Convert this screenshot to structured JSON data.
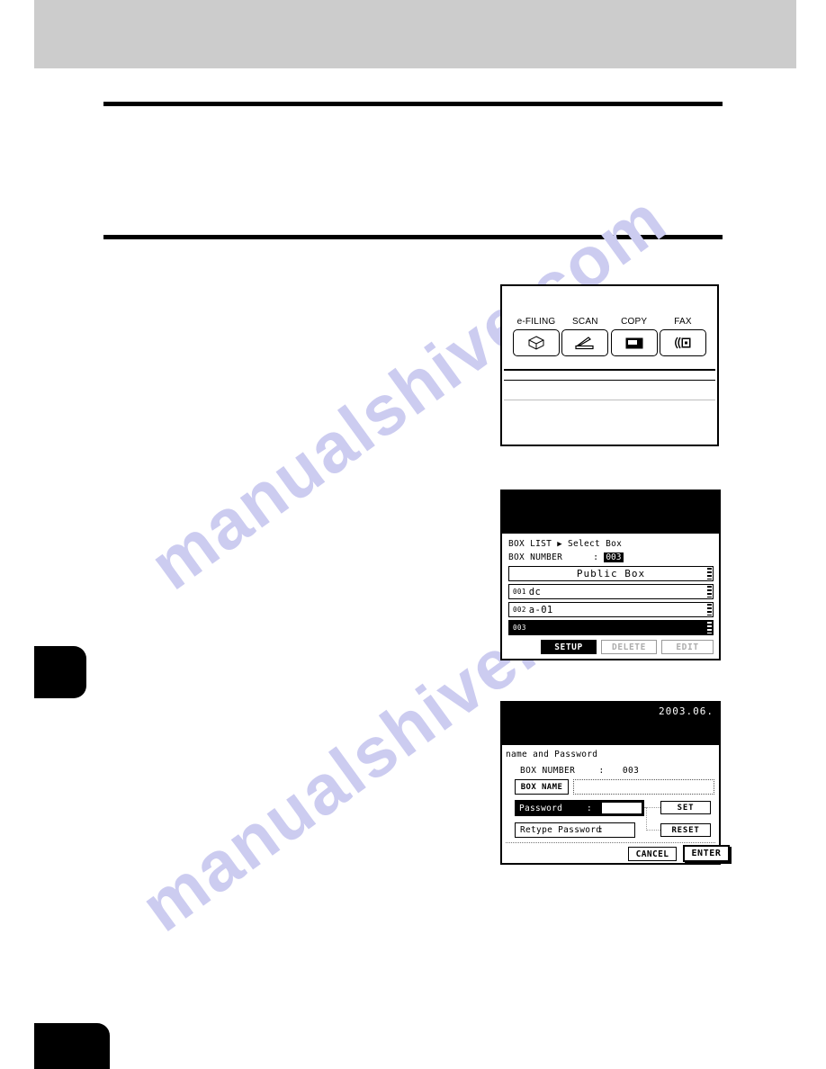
{
  "page": {
    "watermark_line_1": "manualshive.com",
    "watermark_line_2": "manualshive.com"
  },
  "panel_functions": {
    "name": "function-select-panel",
    "keys": [
      {
        "label": "e-FILING",
        "icon": "efiling-box-icon"
      },
      {
        "label": "SCAN",
        "icon": "scanner-icon"
      },
      {
        "label": "COPY",
        "icon": "copy-page-icon"
      },
      {
        "label": "FAX",
        "icon": "fax-icon"
      }
    ]
  },
  "panel_boxlist": {
    "title_label": "BOX LIST",
    "title_arrow": "▶",
    "title_sub": "Select Box",
    "box_number_label": "BOX NUMBER",
    "box_number_sep": ":",
    "box_number_value": "003",
    "rows": [
      {
        "index": "",
        "name": "Public Box",
        "selected": false
      },
      {
        "index": "001",
        "name": "dc",
        "selected": false
      },
      {
        "index": "002",
        "name": "a-01",
        "selected": false
      },
      {
        "index": "003",
        "name": "",
        "selected": true
      }
    ],
    "buttons": [
      {
        "label": "SETUP",
        "state": "active"
      },
      {
        "label": "DELETE",
        "state": "disabled"
      },
      {
        "label": "EDIT",
        "state": "disabled"
      }
    ]
  },
  "panel_password": {
    "date": "2003.06.",
    "heading": "name and Password",
    "box_number_label": "BOX NUMBER",
    "box_number_sep": ":",
    "box_number_value": "003",
    "box_name_button": "BOX NAME",
    "box_name_value": "",
    "password_label": "Password",
    "password_sep": ":",
    "password_value": "",
    "retype_label": "Retype Password",
    "retype_sep": ":",
    "retype_value": "",
    "set_button": "SET",
    "reset_button": "RESET",
    "cancel_button": "CANCEL",
    "enter_button": "ENTER"
  }
}
